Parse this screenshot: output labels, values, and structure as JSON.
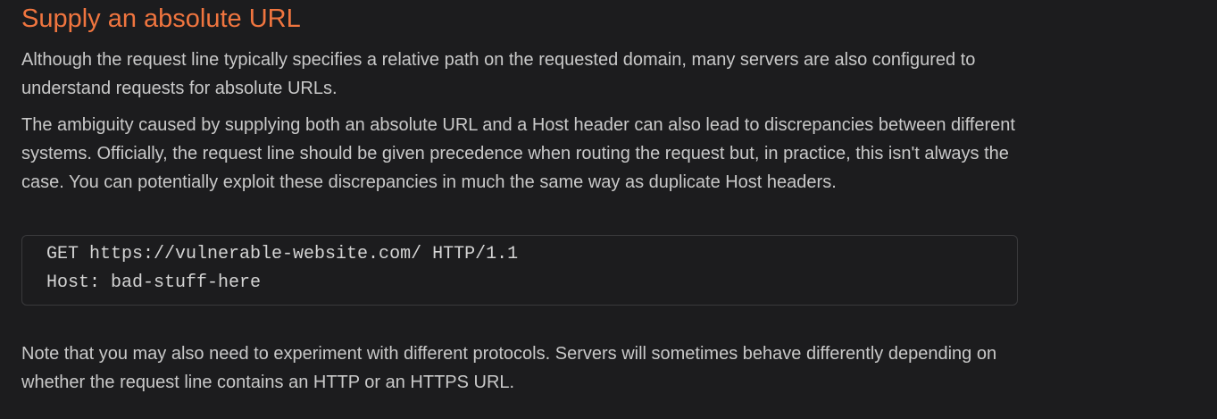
{
  "section": {
    "heading": "Supply an absolute URL",
    "paragraphs": [
      "Although the request line typically specifies a relative path on the requested domain, many servers are also configured to understand requests for absolute URLs.",
      "The ambiguity caused by supplying both an absolute URL and a Host header can also lead to discrepancies between different systems. Officially, the request line should be given precedence when routing the request but, in practice, this isn't always the case. You can potentially exploit these discrepancies in much the same way as duplicate Host headers.",
      "Note that you may also need to experiment with different protocols. Servers will sometimes behave differently depending on whether the request line contains an HTTP or an HTTPS URL."
    ],
    "code_lines": [
      "GET https://vulnerable-website.com/ HTTP/1.1",
      "Host: bad-stuff-here"
    ]
  },
  "colors": {
    "background": "#1c1c1e",
    "heading": "#f0753f",
    "text": "#c9c9c9",
    "code_border": "#3a3a3c"
  }
}
